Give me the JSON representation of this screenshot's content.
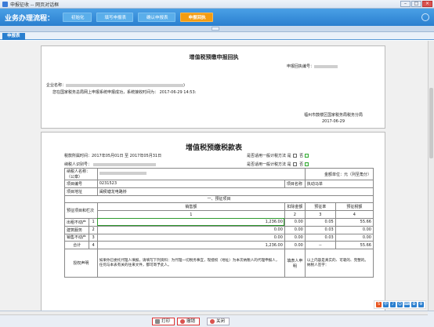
{
  "window": {
    "title": "申报征收 -- 网页对话框"
  },
  "process": {
    "title": "业务办理流程：",
    "steps": [
      "初始化",
      "填写申报表",
      "确认申报表",
      "申报回执"
    ],
    "active_step": 3
  },
  "tab": {
    "label": "申报表"
  },
  "receipt": {
    "title": "增值税预缴申报回执",
    "serial_label": "申报回执编号：",
    "company_label": "企业名称：",
    "line1": "您在国家税务总局网上申报系统申报成功，系统接收时间为：",
    "line1_time": "2017-06-29 14:53:",
    "authority": "福州市鼓楼区国家税务局税务分局",
    "date": "2017-06-29"
  },
  "form": {
    "title": "增值税预缴税款表",
    "period": "税款所属时间：2017年05月01日 至 2017年05月31日",
    "taxpayer_id_label": "纳税人识别号：",
    "is_general_label": "是否适用一般计税方法",
    "is_general_yes": "是",
    "is_general_no": "否",
    "is_cross_label": "是否适用一般计税方法",
    "unit": "金额单位：元（列至角分）",
    "name_label": "纳税人名称：（公章）",
    "project_no_label": "项目编号",
    "project_no": "0231523",
    "project_name_label": "项目名称",
    "project_name": "执动马单",
    "project_addr_label": "项目地址",
    "project_addr": "闽侯塘龙电路桥",
    "section_label": "一、预征项目",
    "col_headers": {
      "item": "预征项目和栏次",
      "sales": "销售额",
      "deduct": "扣除金额",
      "rate": "预征率",
      "tax": "预征税额"
    },
    "col_numbers": [
      "1",
      "2",
      "3",
      "4"
    ],
    "rows": [
      {
        "name": "出租不动产",
        "no": "1",
        "sales": "1,236.00",
        "deduct": "0.00",
        "rate": "0.05",
        "tax": "55.66"
      },
      {
        "name": "建筑服务",
        "no": "2",
        "sales": "0.00",
        "deduct": "0.00",
        "rate": "0.03",
        "tax": "0.00"
      },
      {
        "name": "销售不动产",
        "no": "3",
        "sales": "0.00",
        "deduct": "0.00",
        "rate": "0.03",
        "tax": "0.00"
      },
      {
        "name": "合计",
        "no": "4",
        "sales": "1,236.00",
        "deduct": "0.00",
        "rate": "--",
        "tax": "55.66"
      }
    ],
    "declare_label": "授权声明",
    "declare_text": "如果你已委托代理人填报，请填写下列资料：为代理一切税务事宜，现授权（地址）为本次纳税人的代理申报人，任何与本表有关的往来文件，都可寄予此人。",
    "signer_label": "填表人申明",
    "signer_text": "以上内容是真实的、可靠的、完整的。纳税人签字："
  },
  "buttons": {
    "print": "打印",
    "back": "撤销",
    "close": "关闭"
  },
  "ime": [
    "S",
    "中",
    "♪",
    "☺",
    "⌨",
    "✿",
    "⚙"
  ]
}
